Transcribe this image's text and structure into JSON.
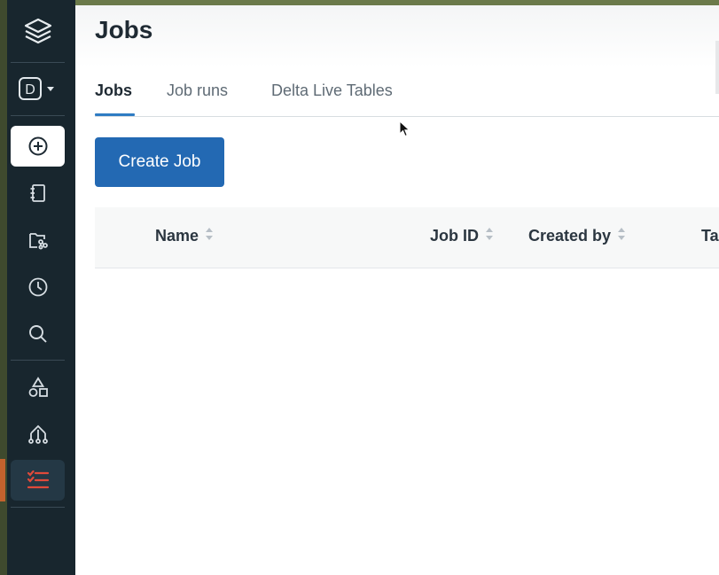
{
  "page": {
    "title": "Jobs"
  },
  "tabs": [
    {
      "label": "Jobs"
    },
    {
      "label": "Job runs"
    },
    {
      "label": "Delta Live Tables"
    }
  ],
  "actions": {
    "create_job": "Create Job"
  },
  "table": {
    "columns": [
      {
        "label": "Name"
      },
      {
        "label": "Job ID"
      },
      {
        "label": "Created by"
      },
      {
        "label": "Ta"
      }
    ]
  },
  "sidebar": {
    "persona_letter": "D",
    "icons": [
      "stack-logo-icon",
      "persona-switcher-icon",
      "create-icon",
      "notebook-icon",
      "repos-icon",
      "recents-icon",
      "search-icon",
      "shapes-icon",
      "workflow-tree-icon",
      "jobs-list-icon"
    ]
  },
  "colors": {
    "sidebar_bg": "#18262e",
    "primary_button": "#2369b3",
    "tab_underline": "#2f7cc3",
    "active_icon": "#e04a3a"
  }
}
